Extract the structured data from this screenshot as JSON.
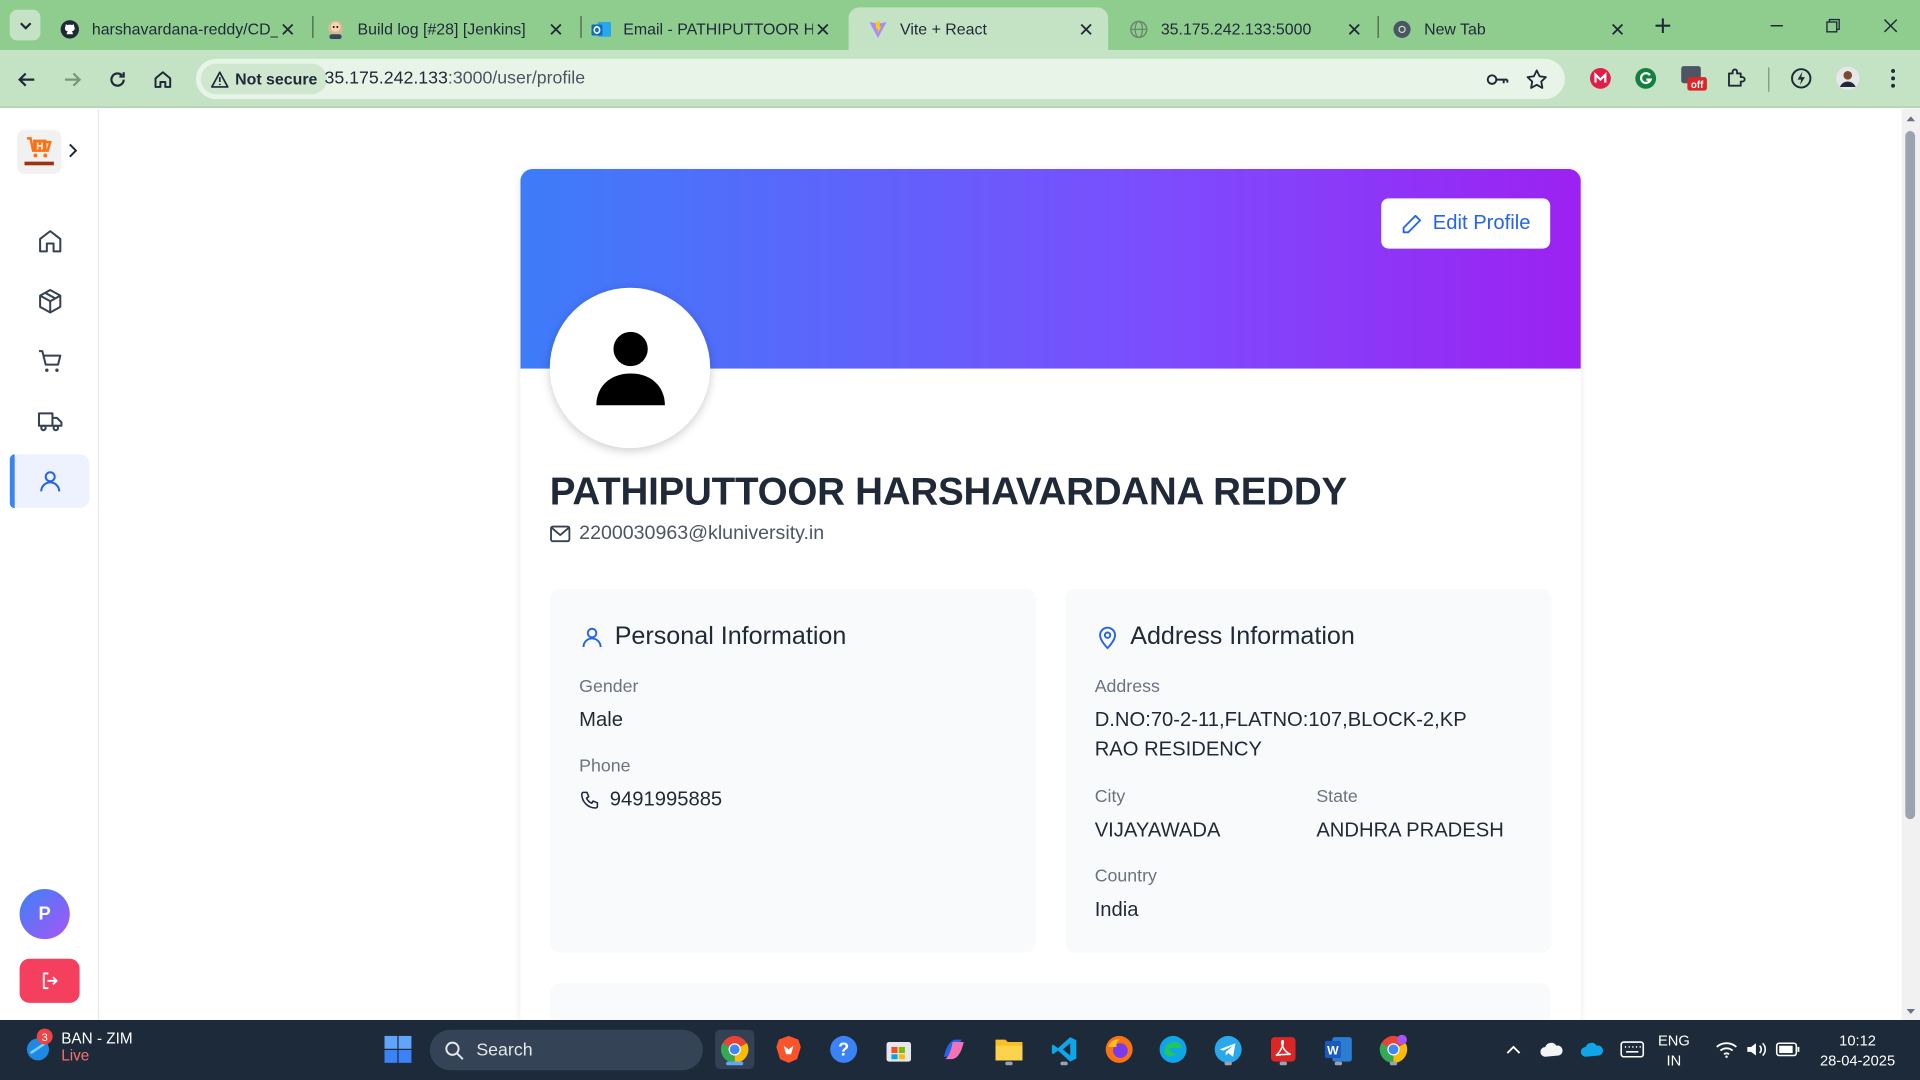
{
  "browser": {
    "tabs": [
      {
        "title": "harshavardana-reddy/CD_Fullstack-Proj",
        "icon": "github-icon"
      },
      {
        "title": "Build log [#28] [Jenkins]",
        "icon": "jenkins-icon"
      },
      {
        "title": "Email - PATHIPUTTOOR HARSHAVARDANA",
        "icon": "outlook-icon"
      },
      {
        "title": "Vite + React",
        "icon": "vite-icon",
        "active": true
      },
      {
        "title": "35.175.242.133:5000",
        "icon": "globe-icon"
      },
      {
        "title": "New Tab",
        "icon": "chrome-icon"
      }
    ],
    "security_chip": "Not secure",
    "url_host": "35.175.242.133",
    "url_rest": ":3000/user/profile"
  },
  "sidebar": {
    "items": [
      "home",
      "products",
      "cart",
      "orders",
      "profile"
    ],
    "active": "profile",
    "avatar_initial": "P"
  },
  "profile": {
    "edit_button": "Edit Profile",
    "name": "PATHIPUTTOOR HARSHAVARDANA REDDY",
    "email": "2200030963@kluniversity.in",
    "personal": {
      "title": "Personal Information",
      "gender_label": "Gender",
      "gender": "Male",
      "phone_label": "Phone",
      "phone": "9491995885"
    },
    "address": {
      "title": "Address Information",
      "address_label": "Address",
      "address": "D.NO:70-2-11,FLATNO:107,BLOCK-2,KP RAO RESIDENCY",
      "city_label": "City",
      "city": "VIJAYAWADA",
      "state_label": "State",
      "state": "ANDHRA PRADESH",
      "country_label": "Country",
      "country": "India"
    }
  },
  "colors": {
    "banner_start": "#3d7cf9",
    "banner_end": "#9c21f2",
    "accent": "#2563eb",
    "logout": "#f43f5e",
    "browser_frame": "#8fcd8f"
  },
  "taskbar": {
    "weather_title": "BAN - ZIM",
    "weather_sub": "Live",
    "weather_badge": "3",
    "search": "Search",
    "lang_1": "ENG",
    "lang_2": "IN",
    "time": "10:12",
    "date": "28-04-2025"
  }
}
